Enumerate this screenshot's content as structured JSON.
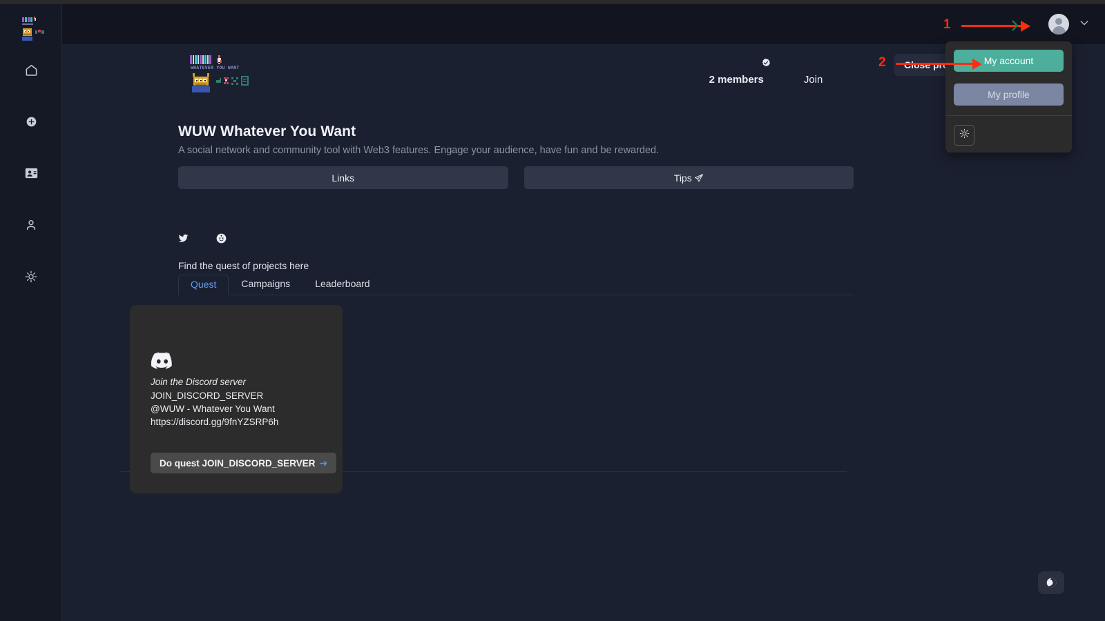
{
  "window": {
    "title": "WUW Whatever You Want"
  },
  "sidebar": {
    "logo_name": "wuw-logo",
    "items": [
      {
        "name": "home",
        "icon": "home-icon"
      },
      {
        "name": "add",
        "icon": "plus-circle-icon"
      },
      {
        "name": "contacts",
        "icon": "id-card-icon"
      },
      {
        "name": "profile",
        "icon": "person-icon"
      },
      {
        "name": "theme",
        "icon": "sun-icon"
      }
    ]
  },
  "header": {
    "avatar_icon": "avatar-icon",
    "chevron_icon": "chevron-down-icon",
    "close_project_label": "Close project"
  },
  "dropdown": {
    "visible": true,
    "my_account_label": "My account",
    "my_profile_label": "My profile",
    "theme_icon": "sun-icon",
    "accent_account": "#4cae9b",
    "accent_profile": "#7b86a3"
  },
  "project": {
    "logo_text_main": "WUW",
    "logo_text_sub": "WHATEVER YOU WANT",
    "logo_emoji": "🚀",
    "verified_icon": "verified-badge-icon",
    "members_label": "2 members",
    "join_label": "Join",
    "title": "WUW Whatever You Want",
    "subtitle": "A social network and community tool with Web3 features. Engage your audience, have fun and be rewarded.",
    "buttons": [
      {
        "label": "Links",
        "icon": ""
      },
      {
        "label": "Tips",
        "icon": "send-icon"
      }
    ],
    "socials": [
      {
        "name": "twitter",
        "icon": "twitter-icon"
      },
      {
        "name": "reddit",
        "icon": "reddit-icon"
      }
    ]
  },
  "quests_section": {
    "label": "Find the quest of projects here",
    "tabs": [
      {
        "label": "Quest",
        "active": true
      },
      {
        "label": "Campaigns",
        "active": false
      },
      {
        "label": "Leaderboard",
        "active": false
      }
    ],
    "active_tab_color": "#5b9cf0"
  },
  "quest_card": {
    "platform_icon": "discord-icon",
    "title": "Join the Discord server",
    "key": "JOIN_DISCORD_SERVER",
    "handle": "@WUW - Whatever You Want",
    "url": "https://discord.gg/9fnYZSRP6h",
    "button_label": "Do quest JOIN_DISCORD_SERVER",
    "button_arrow": "➜",
    "arrow_color": "#4d8ef7"
  },
  "fab": {
    "icon": "support-globe-icon"
  },
  "annotations": {
    "color": "#fd2d10",
    "markers": [
      {
        "number": "1",
        "target": "avatar-icon"
      },
      {
        "number": "2",
        "target": "my-account-button"
      }
    ]
  }
}
